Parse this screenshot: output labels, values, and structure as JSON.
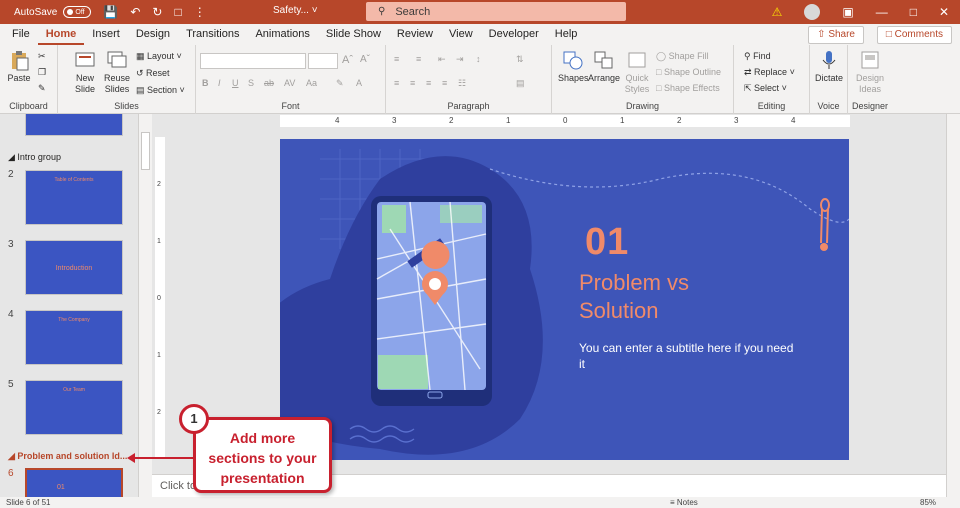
{
  "titlebar": {
    "autosave_label": "AutoSave",
    "autosave_state": "Off",
    "doc_title": "Safety...",
    "search_placeholder": "Search"
  },
  "tabs": [
    "File",
    "Home",
    "Insert",
    "Design",
    "Transitions",
    "Animations",
    "Slide Show",
    "Review",
    "View",
    "Developer",
    "Help"
  ],
  "active_tab": "Home",
  "share_label": "Share",
  "comments_label": "Comments",
  "ribbon": {
    "clipboard": {
      "label": "Clipboard",
      "paste": "Paste"
    },
    "slides": {
      "label": "Slides",
      "new_slide_line1": "New",
      "new_slide_line2": "Slide",
      "reuse_line1": "Reuse",
      "reuse_line2": "Slides",
      "layout": "Layout",
      "reset": "Reset",
      "section": "Section"
    },
    "font": {
      "label": "Font"
    },
    "paragraph": {
      "label": "Paragraph"
    },
    "drawing": {
      "label": "Drawing",
      "shapes": "Shapes",
      "arrange": "Arrange",
      "quick_line1": "Quick",
      "quick_line2": "Styles",
      "fill": "Shape Fill",
      "outline": "Shape Outline",
      "effects": "Shape Effects"
    },
    "editing": {
      "label": "Editing",
      "find": "Find",
      "replace": "Replace",
      "select": "Select"
    },
    "voice": {
      "label": "Voice",
      "dictate": "Dictate"
    },
    "designer": {
      "label": "Designer",
      "ideas_line1": "Design",
      "ideas_line2": "Ideas"
    }
  },
  "thumbnails": [
    {
      "section": "Intro group",
      "number": "2",
      "title": "Table of Contents"
    },
    {
      "number": "3",
      "title": "Introduction"
    },
    {
      "number": "4",
      "title": "The Company"
    },
    {
      "number": "5",
      "title": "Our Team"
    },
    {
      "section": "Problem and solution Id...",
      "number": "6",
      "title": "01"
    }
  ],
  "ruler": {
    "h_ticks": [
      "4",
      "3",
      "2",
      "1",
      "0",
      "1",
      "2",
      "3",
      "4"
    ],
    "v_ticks": [
      "2",
      "1",
      "0",
      "1",
      "2"
    ]
  },
  "slide": {
    "number": "01",
    "title_line1": "Problem vs",
    "title_line2": "Solution",
    "subtitle": "You can enter a subtitle here if you need it"
  },
  "notes_placeholder": "Click to",
  "status": {
    "slide_of": "Slide 6 of 51",
    "notes": "Notes",
    "zoom": "85%"
  },
  "callout": {
    "badge": "1",
    "line1": "Add more",
    "line2": "sections to your",
    "line3": "presentation"
  },
  "colors": {
    "accent": "#b7472a",
    "slide_bg": "#3e55b8",
    "slide_accent": "#f08a69",
    "callout_red": "#c8202e"
  }
}
